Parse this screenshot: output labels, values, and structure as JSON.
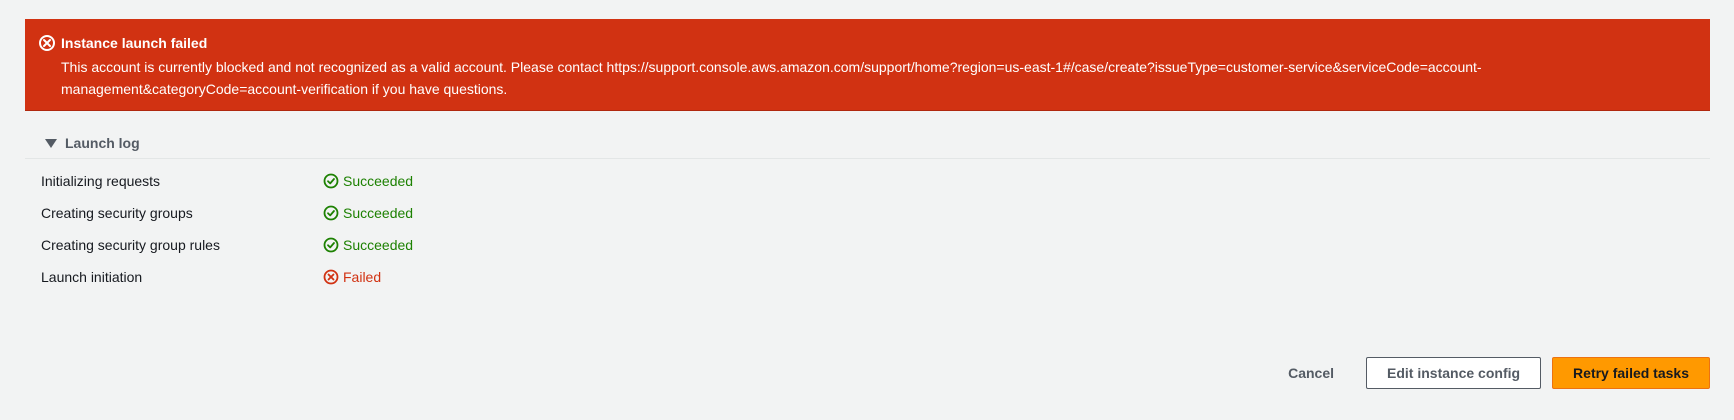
{
  "error": {
    "icon": "error-circle-icon",
    "title": "Instance launch failed",
    "message": "This account is currently blocked and not recognized as a valid account. Please contact https://support.console.aws.amazon.com/support/home?region=us-east-1#/case/create?issueType=customer-service&serviceCode=account-management&categoryCode=account-verification if you have questions.",
    "color": "#d13212"
  },
  "launch_log": {
    "title": "Launch log",
    "caret_icon": "caret-down-icon",
    "rows": [
      {
        "label": "Initializing requests",
        "status": "Succeeded",
        "icon": "check-circle-icon"
      },
      {
        "label": "Creating security groups",
        "status": "Succeeded",
        "icon": "check-circle-icon"
      },
      {
        "label": "Creating security group rules",
        "status": "Succeeded",
        "icon": "check-circle-icon"
      },
      {
        "label": "Launch initiation",
        "status": "Failed",
        "icon": "error-circle-icon"
      }
    ],
    "success_color": "#1d8102",
    "fail_color": "#d13212"
  },
  "actions": {
    "cancel_label": "Cancel",
    "edit_label": "Edit instance config",
    "retry_label": "Retry failed tasks",
    "primary_color": "#ff9900"
  }
}
